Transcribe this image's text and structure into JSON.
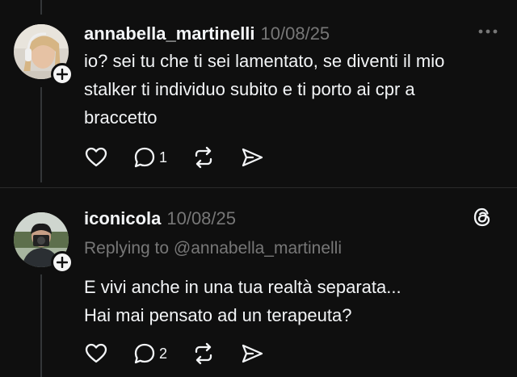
{
  "theme": {
    "background": "#0f0f0f",
    "text": "#f3f5f7",
    "muted": "#777777"
  },
  "posts": [
    {
      "username": "annabella_martinelli",
      "date": "10/08/25",
      "avatar": "avatar-photo-woman-headphones",
      "follow_icon": "plus-icon",
      "menu_icon": "more-dots-icon",
      "lines": [
        "io? sei tu che ti sei lamentato, se diventi il mio",
        "stalker ti individuo subito e ti porto ai cpr a",
        "braccetto"
      ],
      "actions": {
        "like_icon": "heart-icon",
        "reply_icon": "comment-icon",
        "reply_count": "1",
        "repost_icon": "repost-icon",
        "share_icon": "send-icon"
      }
    },
    {
      "username": "iconicola",
      "date": "10/08/25",
      "avatar": "avatar-photo-man-camera",
      "follow_icon": "plus-icon",
      "brand_icon": "threads-logo-icon",
      "replying_to": "Replying to @annabella_martinelli",
      "lines": [
        "E vivi anche in una tua realtà separata...",
        "Hai mai pensato ad un terapeuta?"
      ],
      "actions": {
        "like_icon": "heart-icon",
        "reply_icon": "comment-icon",
        "reply_count": "2",
        "repost_icon": "repost-icon",
        "share_icon": "send-icon"
      }
    }
  ]
}
